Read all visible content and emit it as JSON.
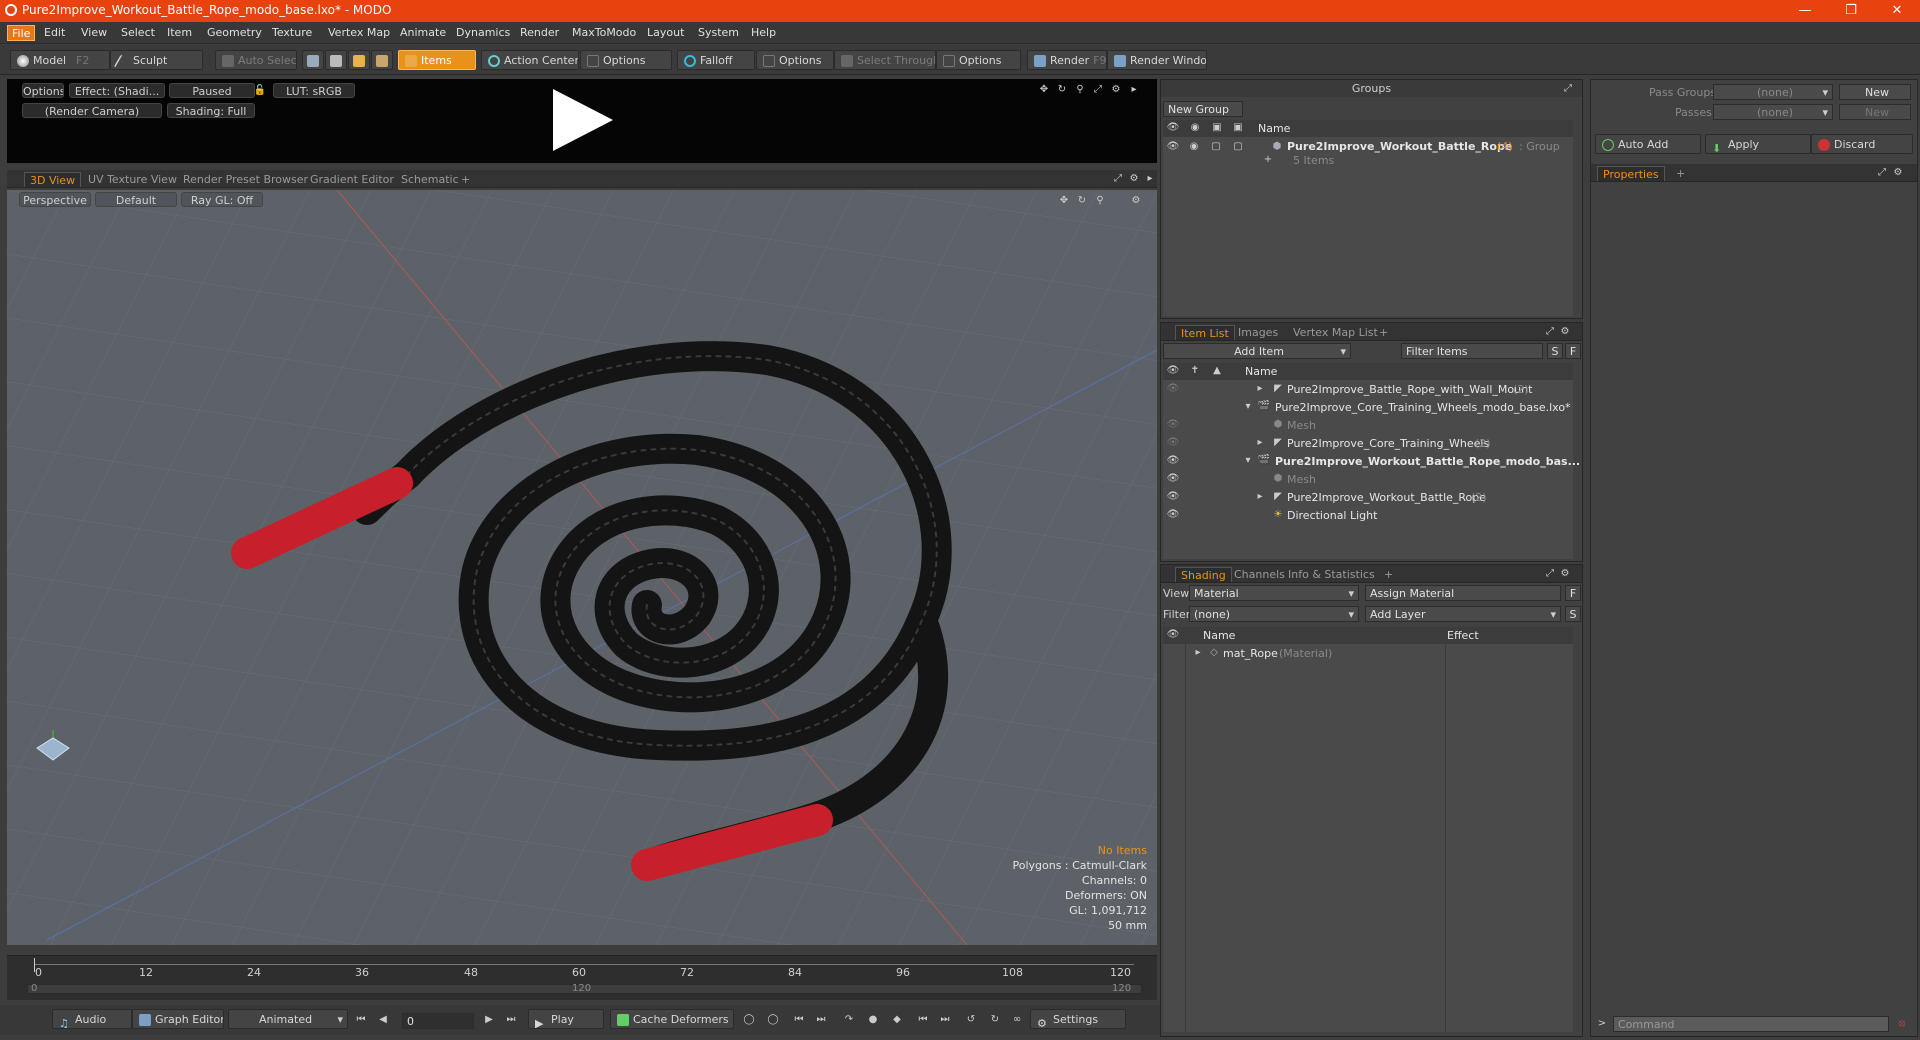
{
  "window": {
    "title": "Pure2Improve_Workout_Battle_Rope_modo_base.lxo* - MODO"
  },
  "menu": [
    "File",
    "Edit",
    "View",
    "Select",
    "Item",
    "Geometry",
    "Texture",
    "Vertex Map",
    "Animate",
    "Dynamics",
    "Render",
    "MaxToModo",
    "Layout",
    "System",
    "Help"
  ],
  "toolbar": {
    "model": "Model",
    "model_key": "F2",
    "sculpt": "Sculpt",
    "auto_select": "Auto Select",
    "items": "Items",
    "action_center": "Action Center",
    "options1": "Options",
    "falloff": "Falloff",
    "options2": "Options",
    "select_through": "Select Through",
    "options3": "Options",
    "render": "Render",
    "render_key": "F9",
    "render_window": "Render Window"
  },
  "preview": {
    "options": "Options",
    "effect": "Effect: (Shadi...",
    "paused": "Paused",
    "lut": "LUT: sRGB",
    "camera": "(Render Camera)",
    "shading": "Shading: Full"
  },
  "viewtabs": [
    "3D View",
    "UV Texture View",
    "Render Preset Browser",
    "Gradient Editor",
    "Schematic",
    "+"
  ],
  "viewport": {
    "perspective": "Perspective",
    "default": "Default",
    "raygl": "Ray GL: Off",
    "info": {
      "no_items": "No Items",
      "polygons": "Polygons : Catmull-Clark",
      "channels": "Channels: 0",
      "deformers": "Deformers: ON",
      "gl": "GL: 1,091,712",
      "scale": "50 mm"
    },
    "colors": {
      "bg": "#5c6268",
      "rope": "#1a1a1a",
      "handle": "#c8202a"
    }
  },
  "timeline": {
    "ticks": [
      "0",
      "12",
      "24",
      "36",
      "48",
      "60",
      "72",
      "84",
      "96",
      "108",
      "120"
    ],
    "sub_start": "0",
    "sub_mid": "120",
    "sub_end": "120"
  },
  "transport": {
    "audio": "Audio",
    "graph_editor": "Graph Editor",
    "animated": "Animated",
    "frame": "0",
    "play": "Play",
    "cache_deformers": "Cache Deformers",
    "settings": "Settings"
  },
  "groups": {
    "title": "Groups",
    "new_group": "New Group",
    "col_name": "Name",
    "item_name": "Pure2Improve_Workout_Battle_Rope",
    "item_count": "(4)",
    "item_type": ": Group",
    "item_sub": "5 Items"
  },
  "passes": {
    "pass_groups_label": "Pass Groups",
    "pass_groups_value": "(none)",
    "new1": "New",
    "passes_label": "Passes",
    "passes_value": "(none)",
    "new2": "New",
    "auto_add": "Auto Add",
    "apply": "Apply",
    "discard": "Discard",
    "properties": "Properties"
  },
  "itemlist": {
    "tabs": [
      "Item List",
      "Images",
      "Vertex Map List",
      "+"
    ],
    "add_item": "Add Item",
    "filter": "Filter Items",
    "s": "S",
    "f": "F",
    "col_name": "Name",
    "rows": [
      {
        "label": "Pure2Improve_Battle_Rope_with_Wall_Mount",
        "suffix": "(2)"
      },
      {
        "label": "Pure2Improve_Core_Training_Wheels_modo_base.lxo*",
        "suffix": ""
      },
      {
        "label": "Mesh",
        "suffix": ""
      },
      {
        "label": "Pure2Improve_Core_Training_Wheels",
        "suffix": "(2)"
      },
      {
        "label": "Pure2Improve_Workout_Battle_Rope_modo_bas...",
        "suffix": ""
      },
      {
        "label": "Mesh",
        "suffix": ""
      },
      {
        "label": "Pure2Improve_Workout_Battle_Rope",
        "suffix": "(2)"
      },
      {
        "label": "Directional Light",
        "suffix": ""
      }
    ]
  },
  "shading": {
    "tabs": [
      "Shading",
      "Channels",
      "Info & Statistics",
      "+"
    ],
    "view_label": "View",
    "view_value": "Material",
    "assign_material": "Assign Material",
    "f": "F",
    "filter_label": "Filter",
    "filter_value": "(none)",
    "add_layer": "Add Layer",
    "s": "S",
    "col_name": "Name",
    "col_effect": "Effect",
    "row_name": "mat_Rope",
    "row_type": "(Material)"
  },
  "command": {
    "placeholder": "Command"
  }
}
